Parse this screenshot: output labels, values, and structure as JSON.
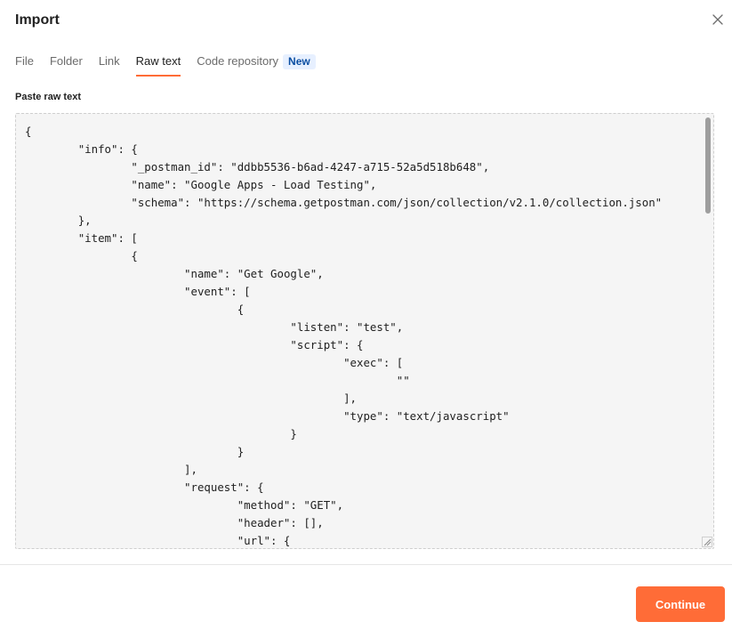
{
  "dialog": {
    "title": "Import",
    "close_icon": "close-icon"
  },
  "tabs": [
    {
      "label": "File",
      "active": false
    },
    {
      "label": "Folder",
      "active": false
    },
    {
      "label": "Link",
      "active": false
    },
    {
      "label": "Raw text",
      "active": true
    },
    {
      "label": "Code repository",
      "active": false,
      "badge": "New"
    }
  ],
  "raw_text": {
    "label": "Paste raw text",
    "lines": [
      "{",
      "\t\"info\": {",
      "\t\t\"_postman_id\": \"ddbb5536-b6ad-4247-a715-52a5d518b648\",",
      "\t\t\"name\": \"Google Apps - Load Testing\",",
      "\t\t\"schema\": \"https://schema.getpostman.com/json/collection/v2.1.0/collection.json\"",
      "\t},",
      "\t\"item\": [",
      "\t\t{",
      "\t\t\t\"name\": \"Get Google\",",
      "\t\t\t\"event\": [",
      "\t\t\t\t{",
      "\t\t\t\t\t\"listen\": \"test\",",
      "\t\t\t\t\t\"script\": {",
      "\t\t\t\t\t\t\"exec\": [",
      "\t\t\t\t\t\t\t\"\"",
      "\t\t\t\t\t\t],",
      "\t\t\t\t\t\t\"type\": \"text/javascript\"",
      "\t\t\t\t\t}",
      "\t\t\t\t}",
      "\t\t\t],",
      "\t\t\t\"request\": {",
      "\t\t\t\t\"method\": \"GET\",",
      "\t\t\t\t\"header\": [],",
      "\t\t\t\t\"url\": {"
    ]
  },
  "footer": {
    "continue_label": "Continue"
  },
  "colors": {
    "accent": "#ff6c37",
    "badge_bg": "#e7f0ff",
    "badge_text": "#0b4ea2"
  }
}
